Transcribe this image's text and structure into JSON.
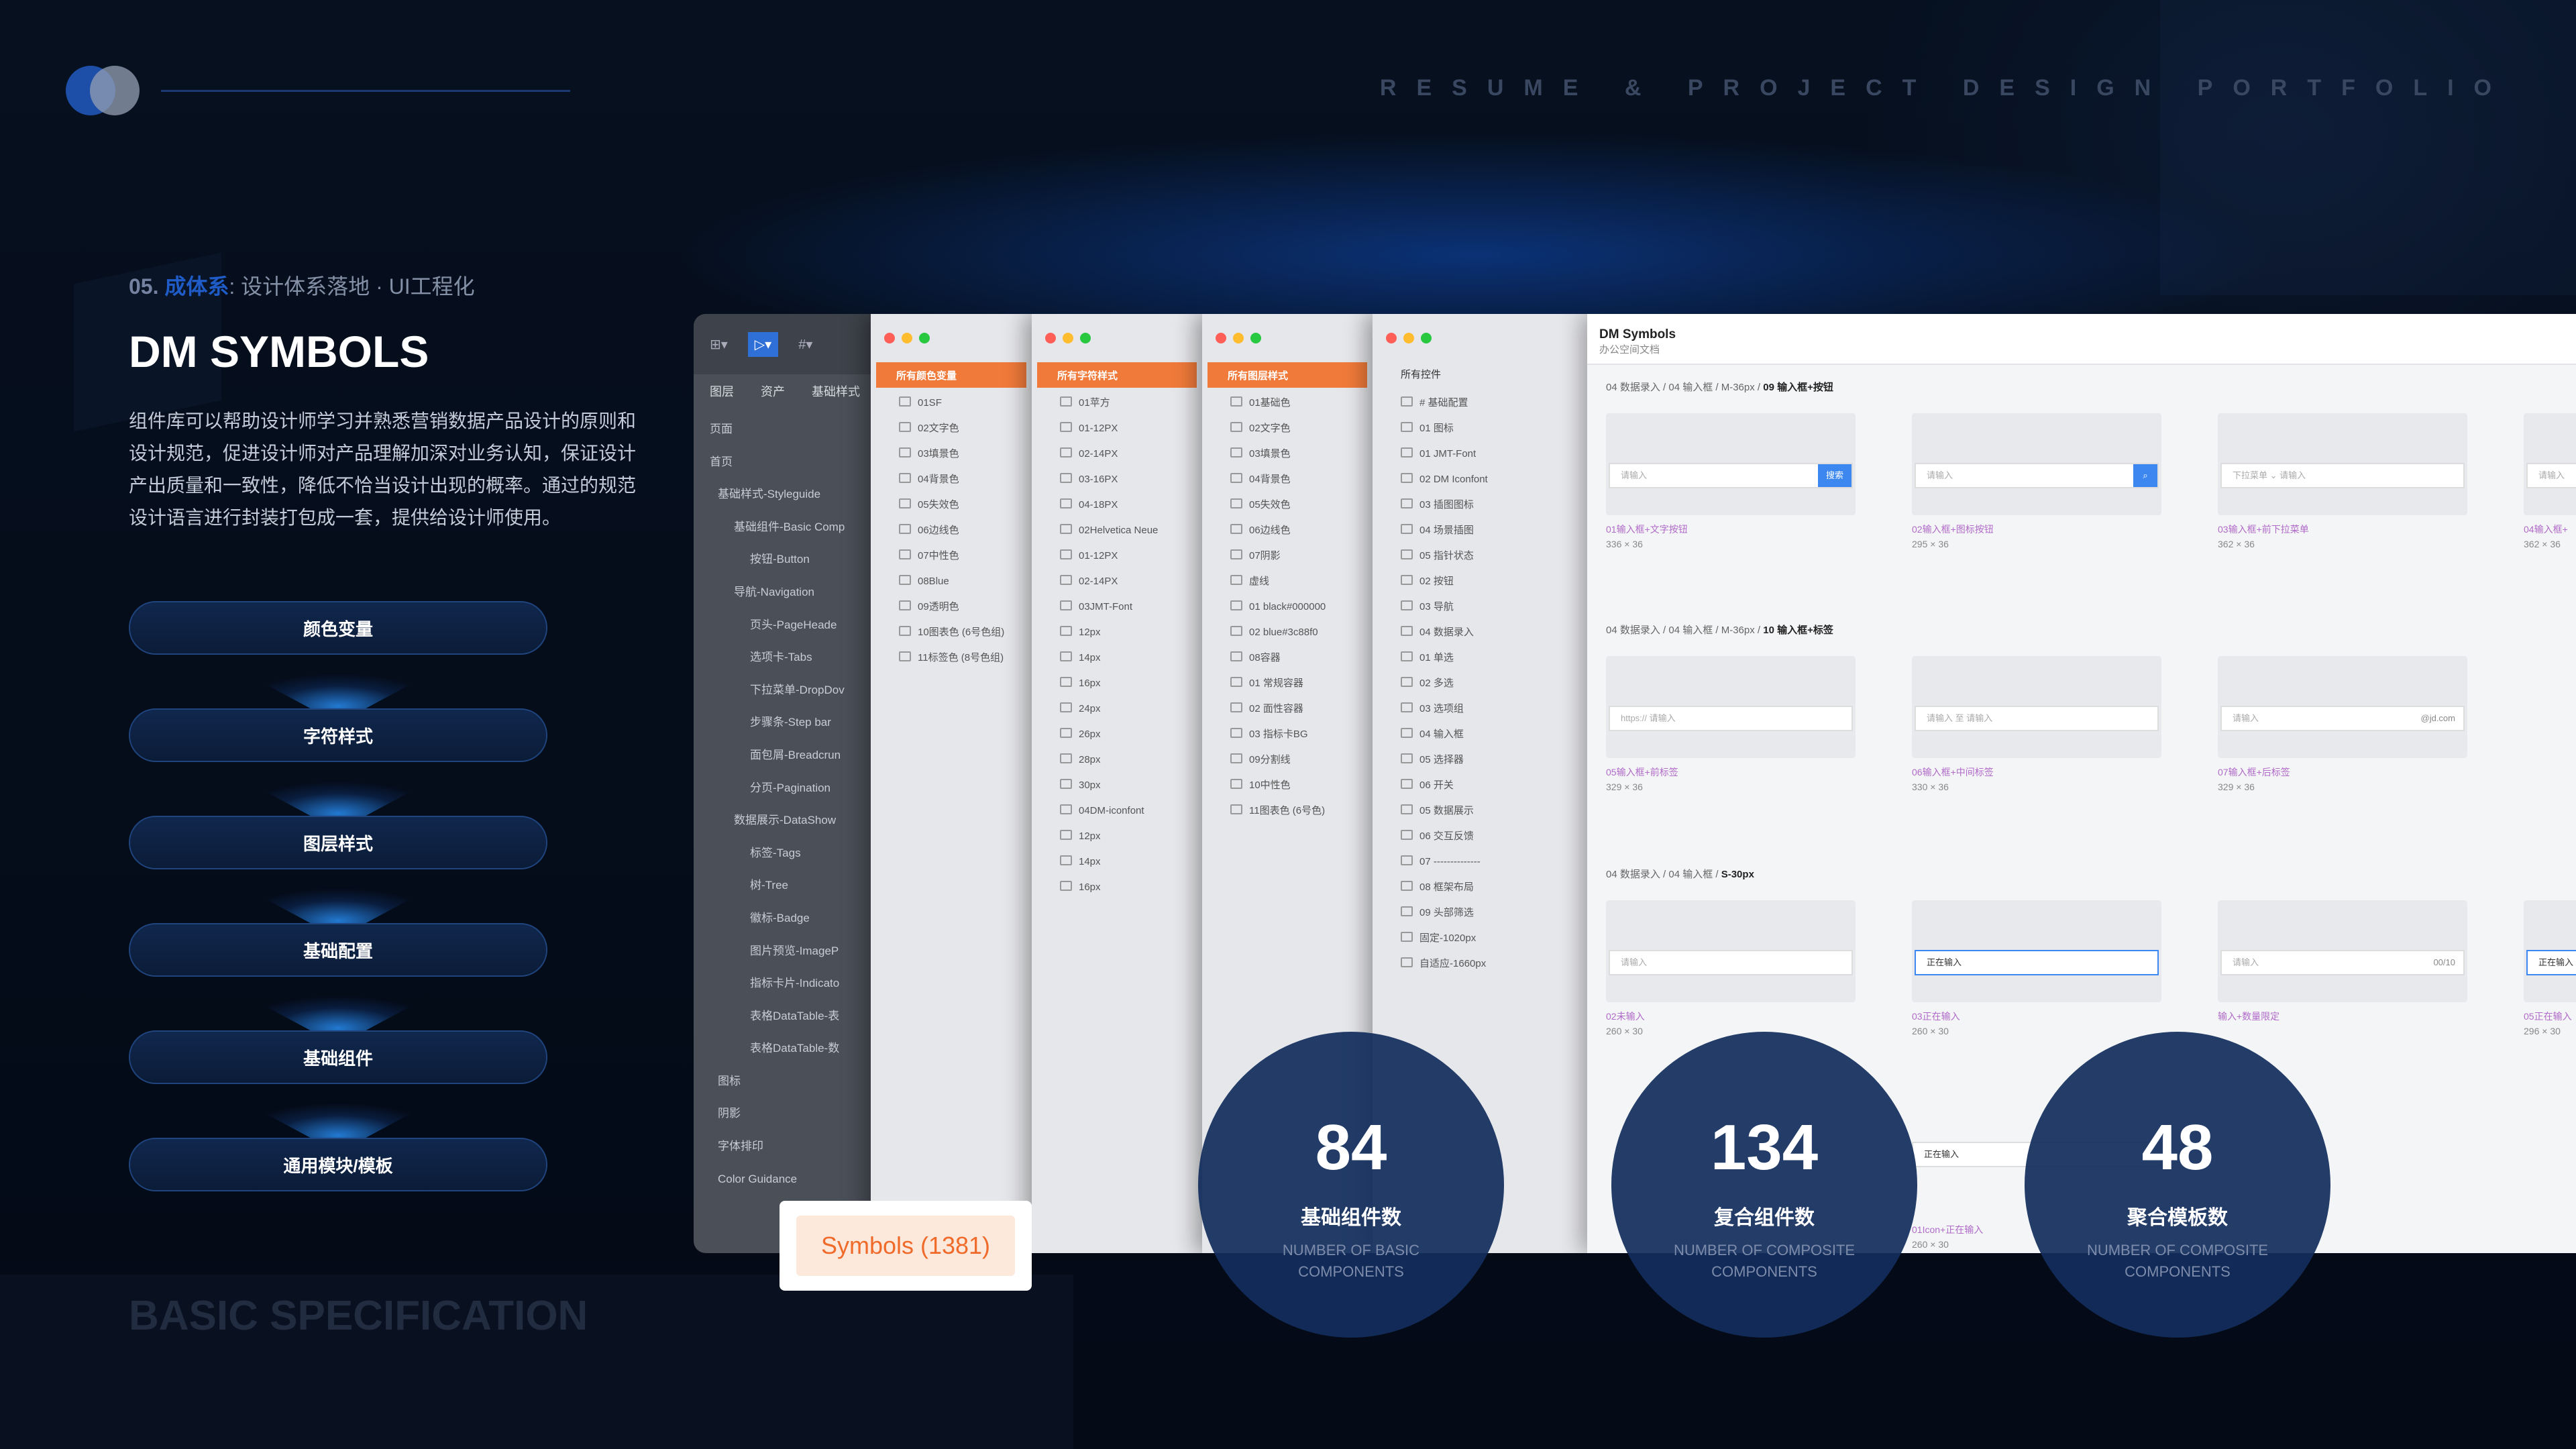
{
  "header": {
    "portfolio": "RESUME & PROJECT DESIGN PORTFOLIO"
  },
  "section": {
    "number": "05.",
    "system": "成体系",
    "rest": "设计体系落地 · UI工程化"
  },
  "title": "DM SYMBOLS",
  "description": "组件库可以帮助设计师学习并熟悉营销数据产品设计的原则和设计规范，促进设计师对产品理解加深对业务认知，保证设计产出质量和一致性，降低不恰当设计出现的概率。通过的规范设计语言进行封装打包成一套，提供给设计师使用。",
  "buttons": [
    "颜色变量",
    "字符样式",
    "图层样式",
    "基础配置",
    "基础组件",
    "通用模块/模板"
  ],
  "footer": "BASIC SPECIFICATION",
  "sidebar": {
    "tabs": [
      "图层",
      "资产",
      "基础样式"
    ],
    "items": [
      "页面",
      "首页",
      "基础样式-Styleguide",
      "基础组件-Basic Comp",
      "按钮-Button",
      "导航-Navigation",
      "页头-PageHeade",
      "选项卡-Tabs",
      "下拉菜单-DropDov",
      "步骤条-Step bar",
      "面包屑-Breadcrun",
      "分页-Pagination",
      "数据展示-DataShow",
      "标签-Tags",
      "树-Tree",
      "徽标-Badge",
      "图片预览-ImageP",
      "指标卡片-Indicato",
      "表格DataTable-表",
      "表格DataTable-数",
      "图标",
      "阴影",
      "字体排印",
      "Color Guidance"
    ]
  },
  "columns": [
    {
      "header": "所有颜色变量",
      "items": [
        "01SF",
        "02文字色",
        "03填景色",
        "04背景色",
        "05失效色",
        "06边线色",
        "07中性色",
        "08Blue",
        "09透明色",
        "10图表色 (6号色组)",
        "11标签色 (8号色组)"
      ]
    },
    {
      "header": "所有字符样式",
      "items": [
        "01苹方",
        "01-12PX",
        "02-14PX",
        "03-16PX",
        "04-18PX",
        "02Helvetica Neue",
        "01-12PX",
        "02-14PX",
        "03JMT-Font",
        "12px",
        "14px",
        "16px",
        "24px",
        "26px",
        "28px",
        "30px",
        "04DM-iconfont",
        "12px",
        "14px",
        "16px"
      ]
    },
    {
      "header": "所有图层样式",
      "items": [
        "01基础色",
        "02文字色",
        "03填景色",
        "04背景色",
        "05失效色",
        "06边线色",
        "07阴影",
        "虚线",
        "01 black#000000",
        "02 blue#3c88f0",
        "08容器",
        "01 常规容器",
        "02 面性容器",
        "03 指标卡BG",
        "09分割线",
        "10中性色",
        "11图表色 (6号色)"
      ]
    },
    {
      "header": "所有控件",
      "items": [
        "# 基础配置",
        "01 图标",
        "01 JMT-Font",
        "02 DM Iconfont",
        "03 插图图标",
        "04 场景插图",
        "05 指针状态",
        "02 按钮",
        "03 导航",
        "04 数据录入",
        "01 单选",
        "02 多选",
        "03 选项组",
        "04 输入框",
        "05 选择器",
        "06 开关",
        "05 数据展示",
        "06 交互反馈",
        "07 --------------",
        "08 框架布局",
        "09 头部筛选",
        "固定-1020px",
        "自适应-1660px"
      ]
    }
  ],
  "main": {
    "title": "DM Symbols",
    "subtitle": "办公空间文档",
    "sections": [
      {
        "crumb": "04 数据录入 / 04 输入框 / M-36px / ",
        "bold": "09 输入框+按钮",
        "cards": [
          {
            "ph": "请输入",
            "extra": "搜索",
            "label": "01输入框+文字按钮",
            "size": "336 × 36"
          },
          {
            "ph": "请输入",
            "extra": "",
            "label": "02输入框+图标按钮",
            "size": "295 × 36"
          },
          {
            "ph": "下拉菜单 ⌄   请输入",
            "extra": "",
            "label": "03输入框+前下拉菜单",
            "size": "362 × 36"
          },
          {
            "ph": "请输入",
            "extra": "",
            "label": "04输入框+",
            "size": "362 × 36"
          }
        ]
      },
      {
        "crumb": "04 数据录入 / 04 输入框 / M-36px / ",
        "bold": "10 输入框+标签",
        "cards": [
          {
            "ph": "https://   请输入",
            "extra": "",
            "label": "05输入框+前标签",
            "size": "329 × 36"
          },
          {
            "ph": "请输入     至     请输入",
            "extra": "",
            "label": "06输入框+中间标签",
            "size": "330 × 36"
          },
          {
            "ph": "请输入",
            "extra": "@jd.com",
            "label": "07输入框+后标签",
            "size": "329 × 36"
          }
        ]
      },
      {
        "crumb": "04 数据录入 / 04 输入框 / ",
        "bold": "S-30px",
        "cards": [
          {
            "ph": "请输入",
            "extra": "",
            "label": "02未输入",
            "size": "260 × 30"
          },
          {
            "ph": "正在输入",
            "extra": "",
            "label": "03正在输入",
            "size": "260 × 30"
          },
          {
            "ph": "请输入",
            "extra": "00/10",
            "label": "输入+数量限定",
            "size": ""
          },
          {
            "ph": "正在输入",
            "extra": "",
            "label": "05正在输入",
            "size": "296 × 30"
          }
        ]
      }
    ],
    "extra": {
      "searching": "正在输入",
      "icon_label": "01Icon+正在输入",
      "icon_size": "260 × 30"
    }
  },
  "stats": [
    {
      "num": "84",
      "zh": "基础组件数",
      "en": "NUMBER OF BASIC COMPONENTS"
    },
    {
      "num": "134",
      "zh": "复合组件数",
      "en": "NUMBER OF COMPOSITE COMPONENTS"
    },
    {
      "num": "48",
      "zh": "聚合模板数",
      "en": "NUMBER OF COMPOSITE COMPONENTS"
    }
  ],
  "symbols": "Symbols (1381)"
}
